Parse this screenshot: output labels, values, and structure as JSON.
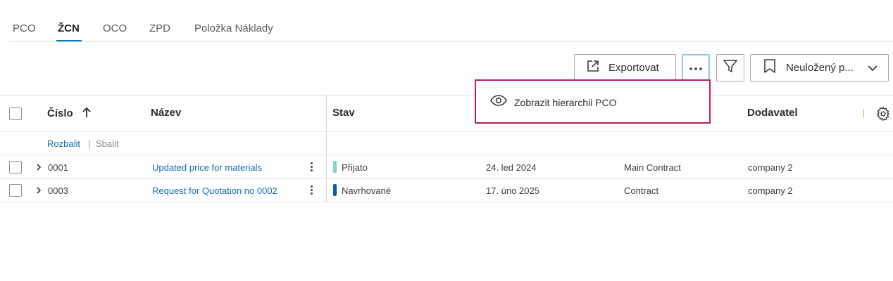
{
  "tabs": [
    {
      "label": "PCO",
      "active": false
    },
    {
      "label": "ŽCN",
      "active": true
    },
    {
      "label": "OCO",
      "active": false
    },
    {
      "label": "ZPD",
      "active": false
    },
    {
      "label": "Položka Náklady",
      "active": false
    }
  ],
  "toolbar": {
    "export_label": "Exportovat",
    "view_label": "Neuložený p..."
  },
  "menu": {
    "hierarchy_label": "Zobrazit hierarchii PCO"
  },
  "table": {
    "columns": {
      "number": "Číslo",
      "name": "Název",
      "status": "Stav",
      "supplier": "Dodavatel"
    },
    "expand_label": "Rozbalit",
    "separator": "|",
    "collapse_label": "Sbalit",
    "rows": [
      {
        "number": "0001",
        "name": "Updated price for materials",
        "status": "Přijato",
        "status_color": "#7fd3cc",
        "date": "24. led 2024",
        "contract": "Main Contract",
        "supplier": "company 2"
      },
      {
        "number": "0003",
        "name": "Request for Quotation no 0002",
        "status": "Navrhované",
        "status_color": "#0a5fa0",
        "date": "17. úno 2025",
        "contract": "Contract",
        "supplier": "company 2"
      }
    ]
  },
  "colors": {
    "accent": "#0a7dc2",
    "link": "#0f6fa8",
    "highlight": "#b5206f"
  }
}
